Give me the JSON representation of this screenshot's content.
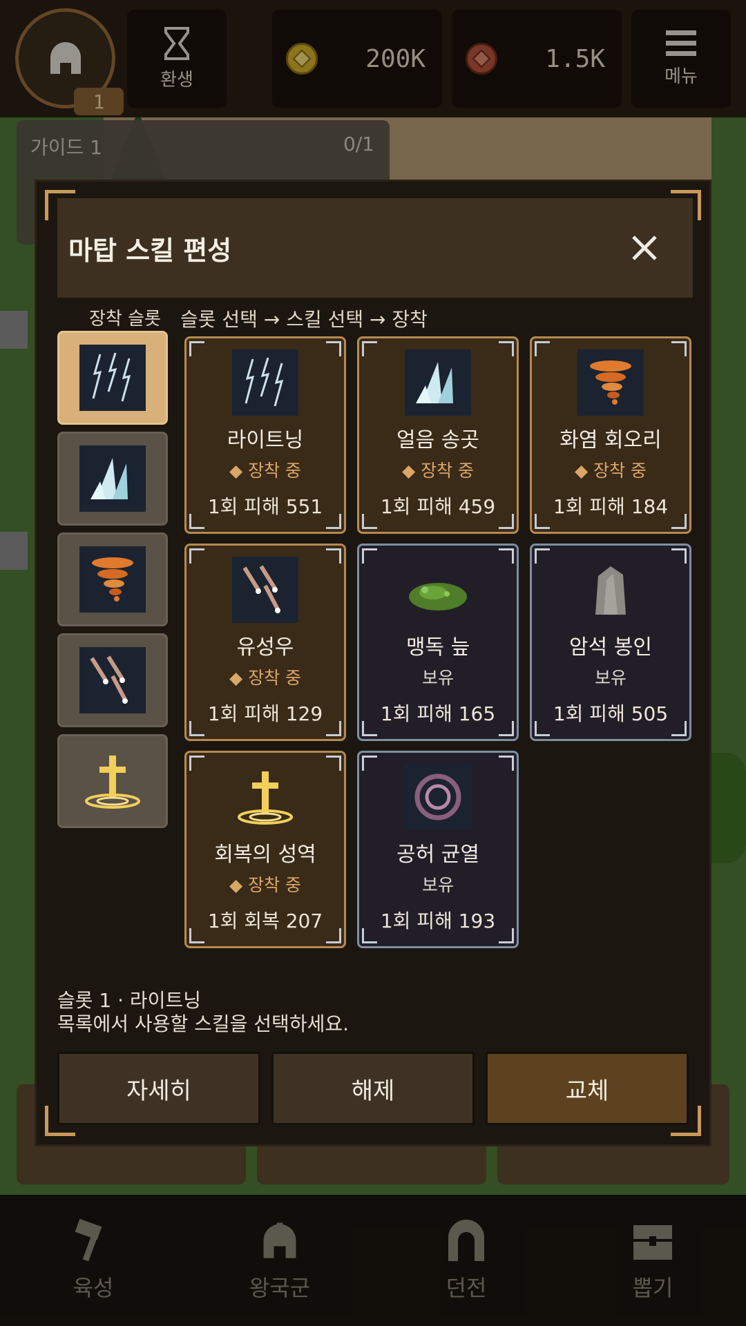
{
  "topbar": {
    "level": "1",
    "rebirth_label": "환생",
    "gold_amount": "200K",
    "gem_amount": "1.5K",
    "menu_label": "메뉴"
  },
  "guide": {
    "title": "가이드 1",
    "progress": "0/1"
  },
  "modal": {
    "title": "마탑 스킬 편성",
    "slots_label": "장착 슬롯",
    "flow_label": "슬롯 선택 → 스킬 선택 → 장착",
    "slots": [
      {
        "icon": "lightning-icon",
        "active": true
      },
      {
        "icon": "ice-spike-icon",
        "active": false
      },
      {
        "icon": "fire-tornado-icon",
        "active": false
      },
      {
        "icon": "meteor-icon",
        "active": false
      },
      {
        "icon": "holy-cross-icon",
        "active": false
      }
    ],
    "skills": [
      {
        "name": "라이트닝",
        "status": "◆ 장착 중",
        "effect": "1회 피해 551",
        "state": "equipped",
        "icon": "lightning-icon"
      },
      {
        "name": "얼음 송곳",
        "status": "◆ 장착 중",
        "effect": "1회 피해 459",
        "state": "equipped",
        "icon": "ice-spike-icon"
      },
      {
        "name": "화염 회오리",
        "status": "◆ 장착 중",
        "effect": "1회 피해 184",
        "state": "equipped",
        "icon": "fire-tornado-icon"
      },
      {
        "name": "유성우",
        "status": "◆ 장착 중",
        "effect": "1회 피해 129",
        "state": "equipped",
        "icon": "meteor-icon"
      },
      {
        "name": "맹독 늪",
        "status": "보유",
        "effect": "1회 피해 165",
        "state": "owned",
        "icon": "poison-swamp-icon"
      },
      {
        "name": "암석 봉인",
        "status": "보유",
        "effect": "1회 피해 505",
        "state": "owned",
        "icon": "rock-seal-icon"
      },
      {
        "name": "회복의 성역",
        "status": "◆ 장착 중",
        "effect": "1회 회복 207",
        "state": "equipped",
        "icon": "holy-cross-icon"
      },
      {
        "name": "공허 균열",
        "status": "보유",
        "effect": "1회 피해 193",
        "state": "owned",
        "icon": "void-rift-icon"
      }
    ],
    "info_line1": "슬롯 1 · 라이트닝",
    "info_line2": "목록에서 사용할 스킬을 선택하세요.",
    "buttons": {
      "details": "자세히",
      "unequip": "해제",
      "replace": "교체"
    }
  },
  "bottomnav": {
    "items": [
      {
        "label": "육성",
        "icon": "hammer-icon"
      },
      {
        "label": "왕국군",
        "icon": "helmet-icon"
      },
      {
        "label": "던전",
        "icon": "dungeon-gate-icon"
      },
      {
        "label": "뽑기",
        "icon": "chest-icon"
      }
    ]
  },
  "colors": {
    "accent_gold": "#c8995a",
    "equipped_border": "#b58a4f",
    "owned_border": "#7d8fa3",
    "active_slot": "#d8b079"
  }
}
